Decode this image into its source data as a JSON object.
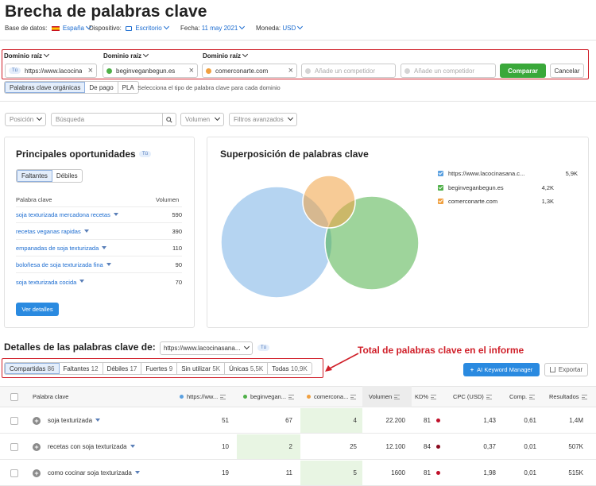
{
  "page": {
    "title": "Brecha de palabras clave"
  },
  "meta": {
    "database_label": "Base de datos:",
    "database_value": "España",
    "device_label": "Dispositivo:",
    "device_value": "Escritorio",
    "date_label": "Fecha:",
    "date_value": "11 may 2021",
    "currency_label": "Moneda:",
    "currency_value": "USD"
  },
  "domains": {
    "label": "Dominio raíz",
    "you_badge": "Tú",
    "field1": "https://www.lacocinasana.com/",
    "field2": "beginveganbegun.es",
    "field3": "comerconarte.com",
    "placeholder": "Añade un competidor",
    "compare": "Comparar",
    "cancel": "Cancelar"
  },
  "type_tabs": {
    "items": [
      "Palabras clave orgánicas",
      "De pago",
      "PLA"
    ],
    "active": 0,
    "hint": "Selecciona el tipo de palabra clave para cada dominio"
  },
  "filters": {
    "position": "Posición",
    "search_placeholder": "Búsqueda",
    "volume": "Volumen",
    "advanced": "Filtros avanzados"
  },
  "opportunities": {
    "title": "Principales oportunidades",
    "you_badge": "Tú",
    "tabs": [
      "Faltantes",
      "Débiles"
    ],
    "active_tab": 0,
    "col_keyword": "Palabra clave",
    "col_volume": "Volumen",
    "rows": [
      {
        "keyword": "soja texturizada mercadona recetas",
        "volume": "590"
      },
      {
        "keyword": "recetas veganas rapidas",
        "volume": "390"
      },
      {
        "keyword": "empanadas de soja texturizada",
        "volume": "110"
      },
      {
        "keyword": "boloñesa de soja texturizada fina",
        "volume": "90"
      },
      {
        "keyword": "soja texturizada cocida",
        "volume": "70"
      }
    ],
    "details_button": "Ver detalles"
  },
  "overlap": {
    "title": "Superposición de palabras clave",
    "legend": [
      {
        "name": "https://www.lacocinasana.c...",
        "value": "5,9K",
        "color": "#5aa0e0"
      },
      {
        "name": "beginveganbegun.es",
        "value": "4,2K",
        "color": "#4fb048"
      },
      {
        "name": "comerconarte.com",
        "value": "1,3K",
        "color": "#f0a040"
      }
    ]
  },
  "details": {
    "title": "Detalles de las palabras clave de:",
    "domain_value": "https://www.lacocinasana...",
    "you_badge": "Tú",
    "annotation": "Total de palabras clave en el informe",
    "tabs": [
      {
        "label": "Compartidas",
        "count": "86"
      },
      {
        "label": "Faltantes",
        "count": "12"
      },
      {
        "label": "Débiles",
        "count": "17"
      },
      {
        "label": "Fuertes",
        "count": "9"
      },
      {
        "label": "Sin utilizar",
        "count": "5K"
      },
      {
        "label": "Únicas",
        "count": "5,5K"
      },
      {
        "label": "Todas",
        "count": "10,9K"
      }
    ],
    "active_tab": 0,
    "ai_button": "AI Keyword Manager",
    "export_button": "Exportar"
  },
  "table": {
    "headers": {
      "keyword": "Palabra clave",
      "d1": "https://ww...",
      "d2": "beginvegan...",
      "d3": "comercona...",
      "volume": "Volumen",
      "kd": "KD%",
      "cpc": "CPC (USD)",
      "comp": "Comp.",
      "results": "Resultados"
    },
    "rows": [
      {
        "keyword": "soja texturizada",
        "d1": "51",
        "d2": "67",
        "d3": "4",
        "volume": "22.200",
        "kd": "81",
        "cpc": "1,43",
        "comp": "0,61",
        "results": "1,4M"
      },
      {
        "keyword": "recetas con soja texturizada",
        "d1": "10",
        "d2": "2",
        "d3": "25",
        "volume": "12.100",
        "kd": "84",
        "cpc": "0,37",
        "comp": "0,01",
        "results": "507K"
      },
      {
        "keyword": "como cocinar soja texturizada",
        "d1": "19",
        "d2": "11",
        "d3": "5",
        "volume": "1600",
        "kd": "81",
        "cpc": "1,98",
        "comp": "0,01",
        "results": "515K"
      }
    ]
  }
}
